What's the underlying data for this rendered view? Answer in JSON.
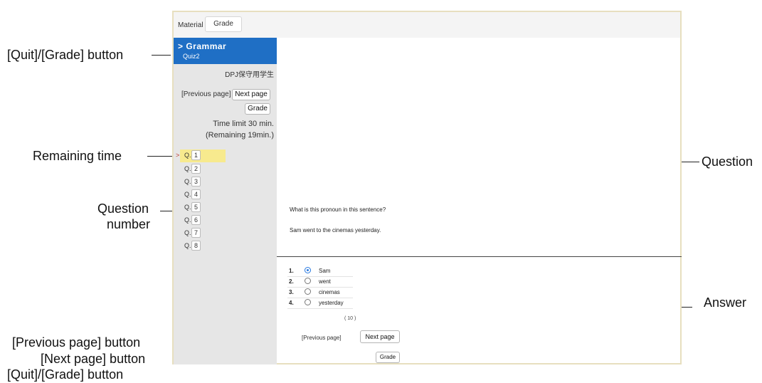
{
  "app": {
    "tabs": {
      "material": "Material",
      "grade": "Grade"
    },
    "sidebar": {
      "course_title": "> Grammar",
      "quiz_name": "Quiz2",
      "student_name": "DPJ保守用学生",
      "prev_page": "[Previous page]",
      "next_page": "Next page",
      "grade": "Grade",
      "time_limit": "Time limit 30 min.",
      "time_remaining": "(Remaining 19min.)",
      "question_prefix": "Q.",
      "questions": [
        "1",
        "2",
        "3",
        "4",
        "5",
        "6",
        "7",
        "8"
      ],
      "current_question": "1"
    },
    "main": {
      "question_text": "What is this pronoun in this sentence?",
      "question_sentence": "Sam went to the cinemas yesterday.",
      "options": [
        {
          "num": "1.",
          "text": "Sam",
          "selected": true
        },
        {
          "num": "2.",
          "text": "went",
          "selected": false
        },
        {
          "num": "3.",
          "text": "cinemas",
          "selected": false
        },
        {
          "num": "4.",
          "text": "yesterday",
          "selected": false
        }
      ],
      "points": "( 10 )",
      "prev_page": "[Previous page]",
      "next_page": "Next page",
      "grade": "Grade"
    }
  },
  "callouts": {
    "quit_grade_top": "[Quit]/[Grade] button",
    "remaining_time": "Remaining time",
    "question_number_line1": "Question",
    "question_number_line2": "number",
    "question": "Question",
    "answer": "Answer",
    "bottom_line1": "[Previous page] button",
    "bottom_line2": "[Next page] button",
    "bottom_line3": "[Quit]/[Grade] button"
  },
  "colors": {
    "accent": "#1f6fc5",
    "highlight": "#f7ea8e",
    "frame_border": "#e7dfbf",
    "radio_selected": "#2b7be0"
  }
}
